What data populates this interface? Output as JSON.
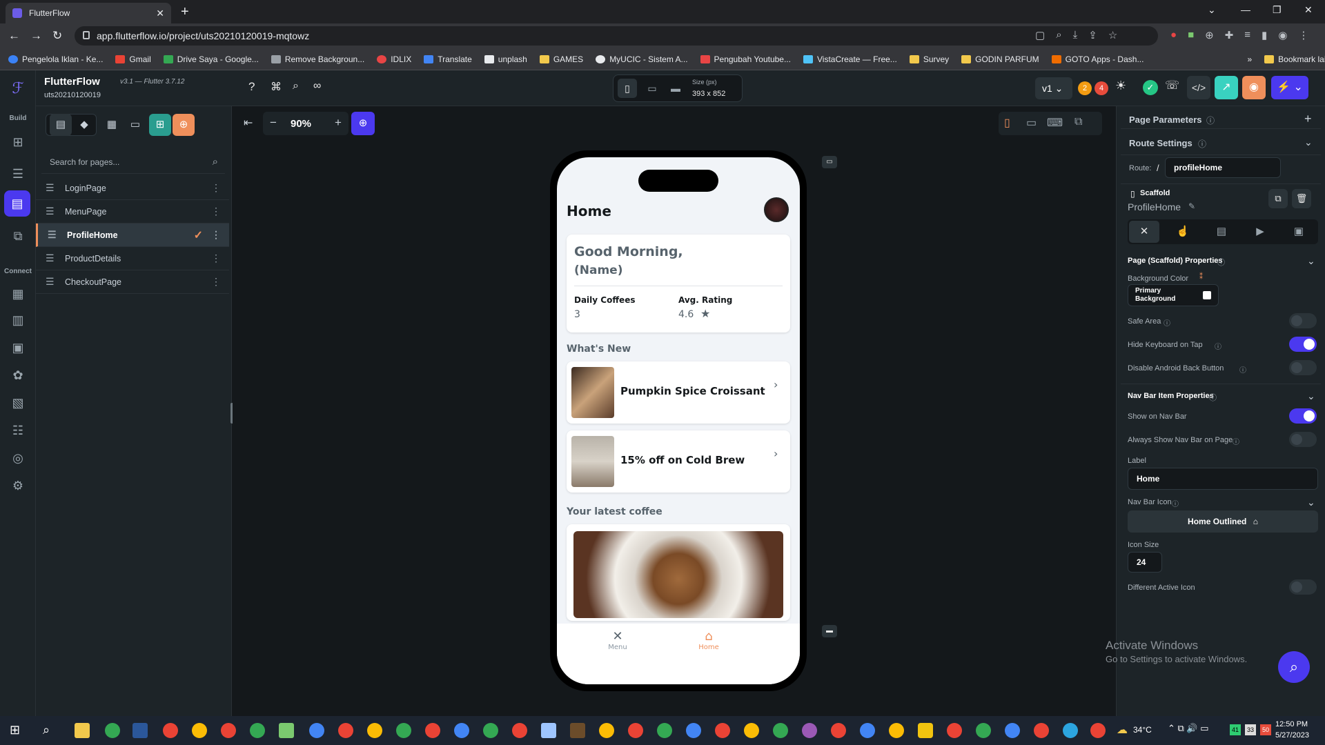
{
  "browser": {
    "tab_title": "FlutterFlow",
    "url": "app.flutterflow.io/project/uts20210120019-mqtowz",
    "bookmarks": [
      "Pengelola Iklan - Ke...",
      "Gmail",
      "Drive Saya - Google...",
      "Remove Backgroun...",
      "IDLIX",
      "Translate",
      "unplash",
      "GAMES",
      "MyUCIC - Sistem A...",
      "Pengubah Youtube...",
      "VistaCreate — Free...",
      "Survey",
      "GODIN PARFUM",
      "GOTO Apps - Dash..."
    ],
    "bookmark_other": "Bookmark lain"
  },
  "app": {
    "name": "FlutterFlow",
    "version": "v3.1 — Flutter 3.7.12",
    "project": "uts20210120019",
    "size_label": "Size (px)",
    "size_value": "393 x 852",
    "zoom": "90%",
    "version_tag": "v1",
    "badge_orange": "2",
    "badge_red": "4"
  },
  "rail": {
    "build": "Build",
    "connect": "Connect"
  },
  "pages": {
    "search_placeholder": "Search for pages...",
    "items": [
      "LoginPage",
      "MenuPage",
      "ProfileHome",
      "ProductDetails",
      "CheckoutPage"
    ]
  },
  "phone": {
    "title": "Home",
    "greeting": "Good Morning,",
    "name": "(Name)",
    "stat1_label": "Daily Coffees",
    "stat1_value": "3",
    "stat2_label": "Avg. Rating",
    "stat2_value": "4.6",
    "section_new": "What's New",
    "item1": "Pumpkin Spice Croissant",
    "item2": "15% off on Cold Brew",
    "section_latest": "Your latest coffee",
    "nav_menu": "Menu",
    "nav_home": "Home"
  },
  "props": {
    "page_params": "Page Parameters",
    "route_settings": "Route Settings",
    "route_label": "Route:",
    "route_slash": "/",
    "route_value": "profileHome",
    "scaffold": "Scaffold",
    "page_name": "ProfileHome",
    "scaffold_props": "Page (Scaffold) Properties",
    "bg_color_label": "Background Color",
    "bg_color_value": "Primary Background",
    "safe_area": "Safe Area",
    "hide_keyboard": "Hide Keyboard on Tap",
    "disable_back": "Disable Android Back Button",
    "navbar_props": "Nav Bar Item Properties",
    "show_nav": "Show on Nav Bar",
    "always_show": "Always Show Nav Bar on Page",
    "label_label": "Label",
    "label_value": "Home",
    "nav_icon_label": "Nav Bar Icon",
    "nav_icon_value": "Home Outlined",
    "icon_size_label": "Icon Size",
    "icon_size_value": "24",
    "diff_active": "Different Active Icon"
  },
  "watermark": {
    "line1": "Activate Windows",
    "line2": "Go to Settings to activate Windows."
  },
  "taskbar": {
    "temp": "34°C",
    "time": "12:50 PM",
    "date": "5/27/2023",
    "n1": "41",
    "n2": "33",
    "n3": "50"
  },
  "colors": {
    "primary": "#4b39ef",
    "accent": "#ef8f5b",
    "bg": "#14181b",
    "panel": "#1d2428"
  }
}
